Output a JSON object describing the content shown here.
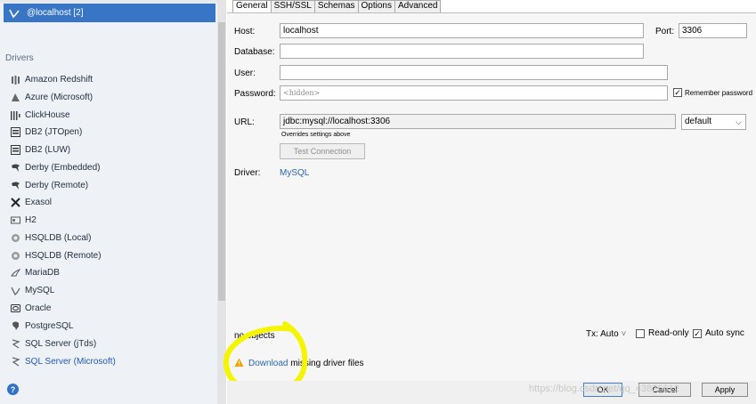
{
  "sidebar": {
    "selected_connection": "@localhost [2]",
    "drivers_header": "Drivers",
    "drivers": [
      {
        "label": "Amazon Redshift",
        "icon": "redshift-icon"
      },
      {
        "label": "Azure (Microsoft)",
        "icon": "azure-icon"
      },
      {
        "label": "ClickHouse",
        "icon": "clickhouse-icon"
      },
      {
        "label": "DB2 (JTOpen)",
        "icon": "db2-icon"
      },
      {
        "label": "DB2 (LUW)",
        "icon": "db2-icon"
      },
      {
        "label": "Derby (Embedded)",
        "icon": "derby-icon"
      },
      {
        "label": "Derby (Remote)",
        "icon": "derby-icon"
      },
      {
        "label": "Exasol",
        "icon": "exasol-icon"
      },
      {
        "label": "H2",
        "icon": "h2-icon"
      },
      {
        "label": "HSQLDB (Local)",
        "icon": "hsqldb-icon"
      },
      {
        "label": "HSQLDB (Remote)",
        "icon": "hsqldb-icon"
      },
      {
        "label": "MariaDB",
        "icon": "mariadb-icon"
      },
      {
        "label": "MySQL",
        "icon": "mysql-icon"
      },
      {
        "label": "Oracle",
        "icon": "oracle-icon"
      },
      {
        "label": "PostgreSQL",
        "icon": "postgresql-icon"
      },
      {
        "label": "SQL Server (jTds)",
        "icon": "sqlserver-icon"
      },
      {
        "label": "SQL Server (Microsoft)",
        "icon": "sqlserver-icon"
      }
    ],
    "help_label": "?"
  },
  "tabs": [
    "General",
    "SSH/SSL",
    "Schemas",
    "Options",
    "Advanced"
  ],
  "form": {
    "host_label": "Host:",
    "host_value": "localhost",
    "port_label": "Port:",
    "port_value": "3306",
    "database_label": "Database:",
    "database_value": "",
    "user_label": "User:",
    "user_value": "",
    "password_label": "Password:",
    "password_placeholder": "<hidden>",
    "remember_password_label": "Remember password",
    "url_label": "URL:",
    "url_value": "jdbc:mysql://localhost:3306",
    "url_note": "Overrides settings above",
    "driver_version_value": "default",
    "test_connection_label": "Test Connection",
    "driver_label": "Driver:",
    "driver_value": "MySQL"
  },
  "footer": {
    "objects_text": "no objects",
    "tx_label": "Tx: Auto",
    "readonly_label": "Read-only",
    "autosync_label": "Auto sync",
    "download_link": "Download",
    "download_rest": " missing driver files",
    "watermark": "https://blog.csdn.net/qq_43826612"
  },
  "dialog_buttons": {
    "ok": "OK",
    "cancel": "Cancel",
    "apply": "Apply"
  },
  "colors": {
    "selection": "#3875c4",
    "link": "#2a66b3",
    "highlight": "#f5f500",
    "warning": "#f0a400"
  }
}
